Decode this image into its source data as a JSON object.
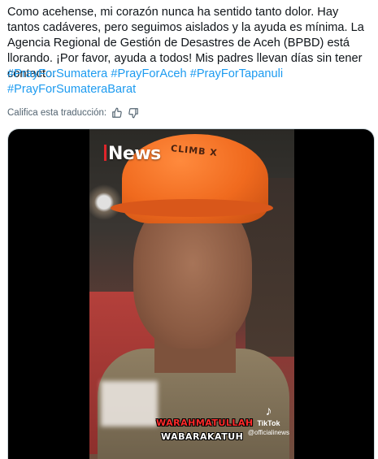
{
  "tweet": {
    "text": "Como acehense, mi corazón nunca ha sentido tanto dolor. Hay tantos cadáveres, pero seguimos aislados y la ayuda es mínima. La Agencia Regional de Gestión de Desastres de Aceh (BPBD) está llorando. ¡Por favor, ayuda a todos! Mis padres llevan días sin tener contacto.",
    "hashtags": [
      "#PrayForSumatera",
      "#PrayForAceh",
      "#PrayForTapanuli",
      "#PrayForSumateraBarat"
    ]
  },
  "translation_rating": {
    "label": "Califica esta traducción:",
    "thumbs_up_icon": "thumbs-up-icon",
    "thumbs_down_icon": "thumbs-down-icon"
  },
  "video": {
    "news_logo": "News",
    "helmet_text": "CLIMB X",
    "caption_line1": "WARAHMATULLAH",
    "caption_line2": "WABARAKATUH",
    "tiktok_label": "TikTok",
    "tiktok_handle": "@officialinews",
    "tiktok_icon": "tiktok-icon"
  }
}
